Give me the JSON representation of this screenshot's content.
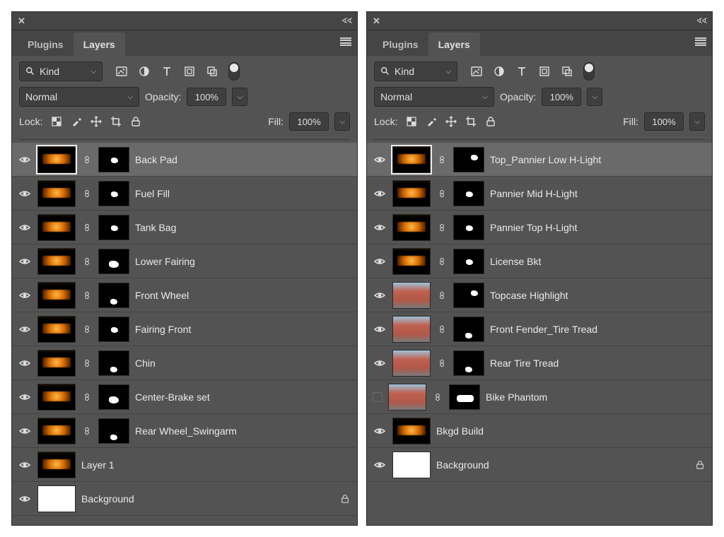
{
  "common": {
    "tabs": {
      "plugins": "Plugins",
      "layers": "Layers"
    },
    "kind_label": "Kind",
    "blend_mode": "Normal",
    "opacity_label": "Opacity:",
    "opacity_value": "100%",
    "lock_label": "Lock:",
    "fill_label": "Fill:",
    "fill_value": "100%"
  },
  "panels": [
    {
      "layers": [
        {
          "name": "Back Pad",
          "visible": true,
          "selected": true,
          "linked": true,
          "mask": "center",
          "thumb": "lit",
          "locked": false
        },
        {
          "name": "Fuel Fill",
          "visible": true,
          "selected": false,
          "linked": true,
          "mask": "center",
          "thumb": "lit",
          "locked": false
        },
        {
          "name": "Tank Bag",
          "visible": true,
          "selected": false,
          "linked": true,
          "mask": "center",
          "thumb": "lit",
          "locked": false
        },
        {
          "name": "Lower Fairing",
          "visible": true,
          "selected": false,
          "linked": true,
          "mask": "big",
          "thumb": "lit",
          "locked": false
        },
        {
          "name": "Front Wheel",
          "visible": true,
          "selected": false,
          "linked": true,
          "mask": "low",
          "thumb": "lit",
          "locked": false
        },
        {
          "name": "Fairing Front",
          "visible": true,
          "selected": false,
          "linked": true,
          "mask": "center",
          "thumb": "lit",
          "locked": false
        },
        {
          "name": "Chin",
          "visible": true,
          "selected": false,
          "linked": true,
          "mask": "low",
          "thumb": "lit",
          "locked": false
        },
        {
          "name": "Center-Brake set",
          "visible": true,
          "selected": false,
          "linked": true,
          "mask": "big",
          "thumb": "lit",
          "locked": false
        },
        {
          "name": "Rear Wheel_Swingarm",
          "visible": true,
          "selected": false,
          "linked": true,
          "mask": "low",
          "thumb": "lit",
          "locked": false
        },
        {
          "name": "Layer 1",
          "visible": true,
          "selected": false,
          "linked": false,
          "mask": null,
          "thumb": "lit",
          "locked": false
        },
        {
          "name": "Background",
          "visible": true,
          "selected": false,
          "linked": false,
          "mask": null,
          "thumb": "white",
          "locked": true
        }
      ]
    },
    {
      "layers": [
        {
          "name": "Top_Pannier Low H-Light",
          "visible": true,
          "selected": true,
          "linked": true,
          "mask": "topr",
          "thumb": "lit",
          "locked": false
        },
        {
          "name": "Pannier Mid H-Light",
          "visible": true,
          "selected": false,
          "linked": true,
          "mask": "center",
          "thumb": "lit",
          "locked": false
        },
        {
          "name": "Pannier Top H-Light",
          "visible": true,
          "selected": false,
          "linked": true,
          "mask": "center",
          "thumb": "lit",
          "locked": false
        },
        {
          "name": "License Bkt",
          "visible": true,
          "selected": false,
          "linked": true,
          "mask": "center",
          "thumb": "lit",
          "locked": false
        },
        {
          "name": "Topcase Highlight",
          "visible": true,
          "selected": false,
          "linked": true,
          "mask": "topr",
          "thumb": "day",
          "locked": false
        },
        {
          "name": "Front Fender_Tire Tread",
          "visible": true,
          "selected": false,
          "linked": true,
          "mask": "low",
          "thumb": "day",
          "locked": false
        },
        {
          "name": "Rear Tire Tread",
          "visible": true,
          "selected": false,
          "linked": true,
          "mask": "low",
          "thumb": "day",
          "locked": false
        },
        {
          "name": "Bike Phantom",
          "visible": false,
          "selected": false,
          "linked": true,
          "mask": "bike",
          "thumb": "day",
          "locked": false
        },
        {
          "name": "Bkgd Build",
          "visible": true,
          "selected": false,
          "linked": false,
          "mask": null,
          "thumb": "lit",
          "locked": false
        },
        {
          "name": "Background",
          "visible": true,
          "selected": false,
          "linked": false,
          "mask": null,
          "thumb": "white",
          "locked": true
        }
      ]
    }
  ]
}
